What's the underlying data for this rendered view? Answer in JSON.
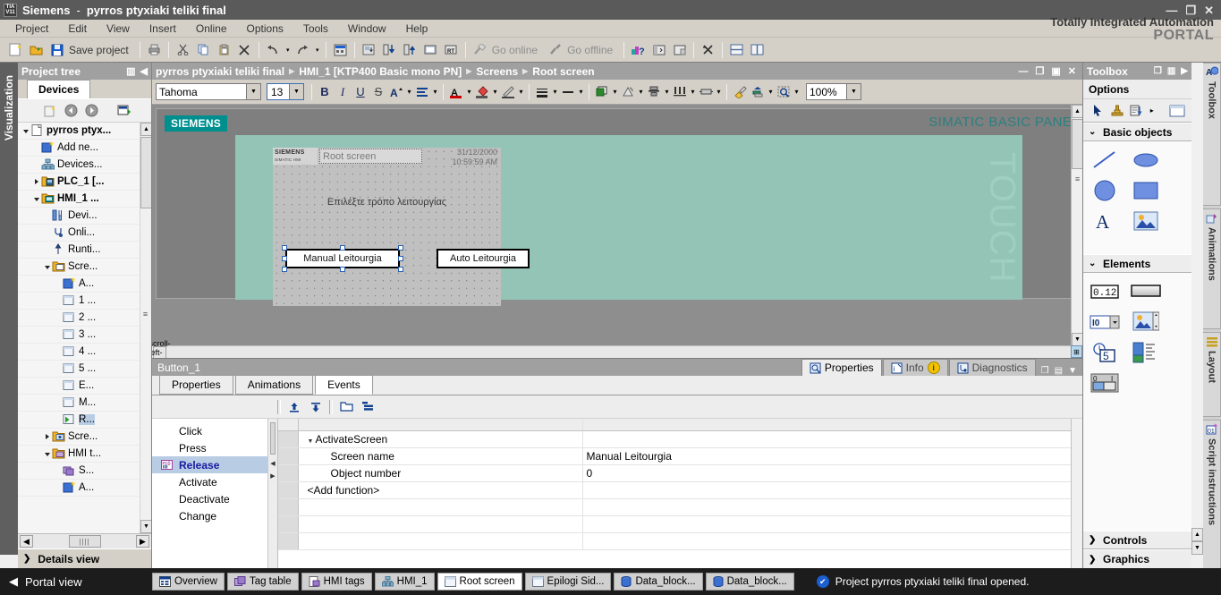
{
  "window": {
    "app_name": "Siemens",
    "separator": "-",
    "project_name": "pyrros ptyxiaki teliki final",
    "logo_line1": "TIA",
    "logo_line2": "V11",
    "minimize": "—",
    "restore": "❐",
    "close": "✕"
  },
  "menu": {
    "items": [
      "Project",
      "Edit",
      "View",
      "Insert",
      "Online",
      "Options",
      "Tools",
      "Window",
      "Help"
    ],
    "brand_line1": "Totally Integrated Automation",
    "brand_line2": "PORTAL"
  },
  "toolbar": {
    "new_project_icon": "new-project-icon",
    "open_project_icon": "open-project-icon",
    "save_icon": "save-icon",
    "save_label": "Save project",
    "print_icon": "print-icon",
    "cut_icon": "cut-icon",
    "copy_icon": "copy-icon",
    "paste_icon": "paste-icon",
    "delete_icon": "delete-icon",
    "undo_icon": "undo-icon",
    "redo_icon": "redo-icon",
    "compile_icon": "compile-icon",
    "download_device_icon": "download-to-device-icon",
    "download_icon": "download-icon",
    "upload_icon": "upload-icon",
    "start_sim_icon": "start-simulation-icon",
    "runtime_icon": "start-runtime-icon",
    "go_online_icon": "go-online-icon",
    "go_online_label": "Go online",
    "go_offline_icon": "go-offline-icon",
    "go_offline_label": "Go offline",
    "help_icon": "online-help-icon",
    "show_hide_left_icon": "show-hide-left-icon",
    "show_hide_right_icon": "show-hide-right-icon",
    "close_all_icon": "close-all-icon",
    "split_horizontal_icon": "split-editor-horizontal-icon",
    "split_vertical_icon": "split-editor-vertical-icon"
  },
  "left_vtab": {
    "label": "Visualization"
  },
  "project_tree": {
    "title": "Project tree",
    "dock_icon": "dock-icon",
    "collapse_icon": "collapse-left-icon",
    "tab_label": "Devices",
    "tools": [
      "new-item-icon",
      "back-icon",
      "forward-icon",
      "snapshot-icon"
    ],
    "items": [
      {
        "label": "pyrros ptyx...",
        "indent": 0,
        "expander": "down",
        "icon": "project-icon",
        "bold": true,
        "selected": false
      },
      {
        "label": "Add ne...",
        "indent": 1,
        "expander": "",
        "icon": "add-device-icon",
        "bold": false,
        "selected": false
      },
      {
        "label": "Devices...",
        "indent": 1,
        "expander": "",
        "icon": "networks-icon",
        "bold": false,
        "selected": false
      },
      {
        "label": "PLC_1 [...",
        "indent": 1,
        "expander": "right",
        "icon": "plc-folder-icon",
        "bold": true,
        "selected": false
      },
      {
        "label": "HMI_1 ...",
        "indent": 1,
        "expander": "down",
        "icon": "hmi-folder-icon",
        "bold": true,
        "selected": false
      },
      {
        "label": "Devi...",
        "indent": 2,
        "expander": "",
        "icon": "device-config-icon",
        "bold": false,
        "selected": false
      },
      {
        "label": "Onli...",
        "indent": 2,
        "expander": "",
        "icon": "online-diag-icon",
        "bold": false,
        "selected": false
      },
      {
        "label": "Runti...",
        "indent": 2,
        "expander": "",
        "icon": "runtime-settings-icon",
        "bold": false,
        "selected": false
      },
      {
        "label": "Scre...",
        "indent": 2,
        "expander": "down",
        "icon": "screens-folder-icon",
        "bold": false,
        "selected": false
      },
      {
        "label": "A...",
        "indent": 3,
        "expander": "",
        "icon": "add-screen-icon",
        "bold": false,
        "selected": false
      },
      {
        "label": "1 ...",
        "indent": 3,
        "expander": "",
        "icon": "screen-icon",
        "bold": false,
        "selected": false
      },
      {
        "label": "2 ...",
        "indent": 3,
        "expander": "",
        "icon": "screen-icon",
        "bold": false,
        "selected": false
      },
      {
        "label": "3 ...",
        "indent": 3,
        "expander": "",
        "icon": "screen-icon",
        "bold": false,
        "selected": false
      },
      {
        "label": "4 ...",
        "indent": 3,
        "expander": "",
        "icon": "screen-icon",
        "bold": false,
        "selected": false
      },
      {
        "label": "5 ...",
        "indent": 3,
        "expander": "",
        "icon": "screen-icon",
        "bold": false,
        "selected": false
      },
      {
        "label": "E...",
        "indent": 3,
        "expander": "",
        "icon": "screen-icon",
        "bold": false,
        "selected": false
      },
      {
        "label": "M...",
        "indent": 3,
        "expander": "",
        "icon": "screen-icon",
        "bold": false,
        "selected": false
      },
      {
        "label": "R...",
        "indent": 3,
        "expander": "",
        "icon": "root-screen-icon",
        "bold": false,
        "selected": true
      },
      {
        "label": "Scre...",
        "indent": 2,
        "expander": "right",
        "icon": "screen-mgmt-icon",
        "bold": false,
        "selected": false
      },
      {
        "label": "HMI t...",
        "indent": 2,
        "expander": "down",
        "icon": "hmi-tags-folder-icon",
        "bold": false,
        "selected": false
      },
      {
        "label": "S...",
        "indent": 3,
        "expander": "",
        "icon": "show-all-tags-icon",
        "bold": false,
        "selected": false
      },
      {
        "label": "A...",
        "indent": 3,
        "expander": "",
        "icon": "add-tag-table-icon",
        "bold": false,
        "selected": false
      }
    ],
    "hscroll_left": "◀",
    "hscroll_right": "▶",
    "details_view": "Details view",
    "details_expander": "❯"
  },
  "editor": {
    "breadcrumb": [
      "pyrros ptyxiaki teliki final",
      "HMI_1 [KTP400 Basic mono PN]",
      "Screens",
      "Root screen"
    ],
    "crumb_arrow": "▶",
    "win_minimize": "—",
    "win_restore": "❐",
    "win_maximize": "▣",
    "win_close": "✕"
  },
  "format_bar": {
    "font_name": "Tahoma",
    "font_size": "13",
    "bold": "B",
    "italic": "I",
    "underline": "U",
    "strikethrough": "S",
    "font_scale_icon": "font-scale-icon",
    "align_icon": "text-align-icon",
    "font_color_icon": "font-color-icon",
    "fill_color_icon": "fill-color-icon",
    "line_color_icon": "line-color-icon",
    "line_style_icon": "line-style-icon",
    "line_weight_icon": "line-weight-icon",
    "fill_pattern_icon": "fill-pattern-icon",
    "rotate_icon": "rotate-icon",
    "align_objects_icon": "align-objects-icon",
    "distribute_icon": "distribute-icon",
    "size_equal_icon": "make-same-size-icon",
    "format_painter_icon": "format-painter-icon",
    "order_icon": "bring-to-front-icon",
    "zoom_select_icon": "zoom-selection-icon",
    "zoom_level": "100%",
    "dropdown_arrow": "▼"
  },
  "hmi_screen": {
    "panel_brand": "SIEMENS",
    "panel_type": "SIMATIC BASIC PANEL",
    "touch_label": "TOUCH",
    "header_brand_1": "SIEMENS",
    "header_brand_2": "SIMATIC HMI",
    "screen_title": "Root screen",
    "date": "31/12/2000",
    "time": "10:59:59 AM",
    "prompt": "Επιλέξτε τρόπο λειτουργίας",
    "button_manual": "Manual Leitourgia",
    "button_auto": "Auto Leitourgia",
    "scroll_left_icon": "scroll-left-icon",
    "zoom_corner_icon": "zoom-corner-icon"
  },
  "inspector": {
    "object_name": "Button_1",
    "right_tabs": [
      {
        "label": "Properties",
        "icon": "properties-icon",
        "active": true,
        "badge": ""
      },
      {
        "label": "Info",
        "icon": "info-icon",
        "active": false,
        "badge": "i"
      },
      {
        "label": "Diagnostics",
        "icon": "diagnostics-icon",
        "active": false,
        "badge": ""
      }
    ],
    "win_float_icon": "float-icon",
    "win_menu_icon": "menu-icon",
    "win_collapse_icon": "collapse-down-icon",
    "tabs": [
      {
        "label": "Properties",
        "active": false
      },
      {
        "label": "Animations",
        "active": false
      },
      {
        "label": "Events",
        "active": true
      }
    ],
    "event_toolbar": [
      "move-up-icon",
      "move-down-icon",
      "open-folder-icon",
      "list-icon"
    ],
    "events": [
      {
        "label": "Click",
        "selected": false
      },
      {
        "label": "Press",
        "selected": false
      },
      {
        "label": "Release",
        "selected": true
      },
      {
        "label": "Activate",
        "selected": false
      },
      {
        "label": "Deactivate",
        "selected": false
      },
      {
        "label": "Change",
        "selected": false
      }
    ],
    "function_rows": [
      {
        "name": "ActivateScreen",
        "value": "",
        "level": 0,
        "expander": "down"
      },
      {
        "name": "Screen name",
        "value": "Manual Leitourgia",
        "level": 1,
        "expander": ""
      },
      {
        "name": "Object number",
        "value": "0",
        "level": 1,
        "expander": ""
      },
      {
        "name": "<Add function>",
        "value": "",
        "level": 0,
        "expander": ""
      },
      {
        "name": "",
        "value": "",
        "level": 0,
        "expander": ""
      },
      {
        "name": "",
        "value": "",
        "level": 0,
        "expander": ""
      },
      {
        "name": "",
        "value": "",
        "level": 0,
        "expander": ""
      }
    ]
  },
  "toolbox": {
    "title": "Toolbox",
    "float_icon": "float-icon",
    "dock_icon": "dock-icon",
    "expand_icon": "expand-right-icon",
    "options_label": "Options",
    "tools": [
      "select-tool-icon",
      "stamp-tool-icon",
      "settings-tool-icon",
      "more-arrow-icon",
      "screen-preview-icon"
    ],
    "sections": [
      {
        "label": "Basic objects",
        "expanded": true,
        "items": [
          "line-icon",
          "ellipse-icon",
          "circle-icon",
          "rectangle-icon",
          "text-field-icon",
          "graphic-view-icon"
        ]
      },
      {
        "label": "Elements",
        "expanded": true,
        "items": [
          "io-field-icon",
          "button-icon",
          "symbolic-io-field-icon",
          "graphic-io-field-icon",
          "date-time-field-icon",
          "bar-icon",
          "switch-icon"
        ]
      },
      {
        "label": "Controls",
        "expanded": false,
        "items": []
      },
      {
        "label": "Graphics",
        "expanded": false,
        "items": []
      }
    ],
    "vtabs": [
      {
        "label": "Toolbox",
        "icon": "toolbox-icon",
        "active": true
      },
      {
        "label": "Animations",
        "icon": "animations-icon",
        "active": false
      },
      {
        "label": "Layout",
        "icon": "layout-icon",
        "active": false
      },
      {
        "label": "Script instructions",
        "icon": "script-icon",
        "active": false
      }
    ],
    "scroll_up": "▲",
    "scroll_down": "▼"
  },
  "statusbar": {
    "portal_view": "Portal view",
    "portal_arrow": "◀",
    "tabs": [
      {
        "label": "Overview",
        "icon": "overview-icon",
        "active": false
      },
      {
        "label": "Tag table",
        "icon": "tag-table-icon",
        "active": false
      },
      {
        "label": "HMI tags",
        "icon": "hmi-tags-icon",
        "active": false
      },
      {
        "label": "HMI_1",
        "icon": "device-icon",
        "active": false
      },
      {
        "label": "Root screen",
        "icon": "screen-icon",
        "active": true
      },
      {
        "label": "Epilogi Sid...",
        "icon": "screen-icon",
        "active": false
      },
      {
        "label": "Data_block...",
        "icon": "data-block-icon",
        "active": false
      },
      {
        "label": "Data_block...",
        "icon": "data-block-icon",
        "active": false
      }
    ],
    "message": "Project pyrros ptyxiaki teliki final opened.",
    "message_icon": "check-icon"
  },
  "colors": {
    "title_bg": "#5a5a5a",
    "chrome_bg": "#d4d0c8",
    "panel_header": "#a0a0a0",
    "accent_teal": "#008f8f",
    "hmi_green": "#93c4b6",
    "selection_blue": "#b8cce4",
    "status_bg": "#1c1c1c"
  }
}
